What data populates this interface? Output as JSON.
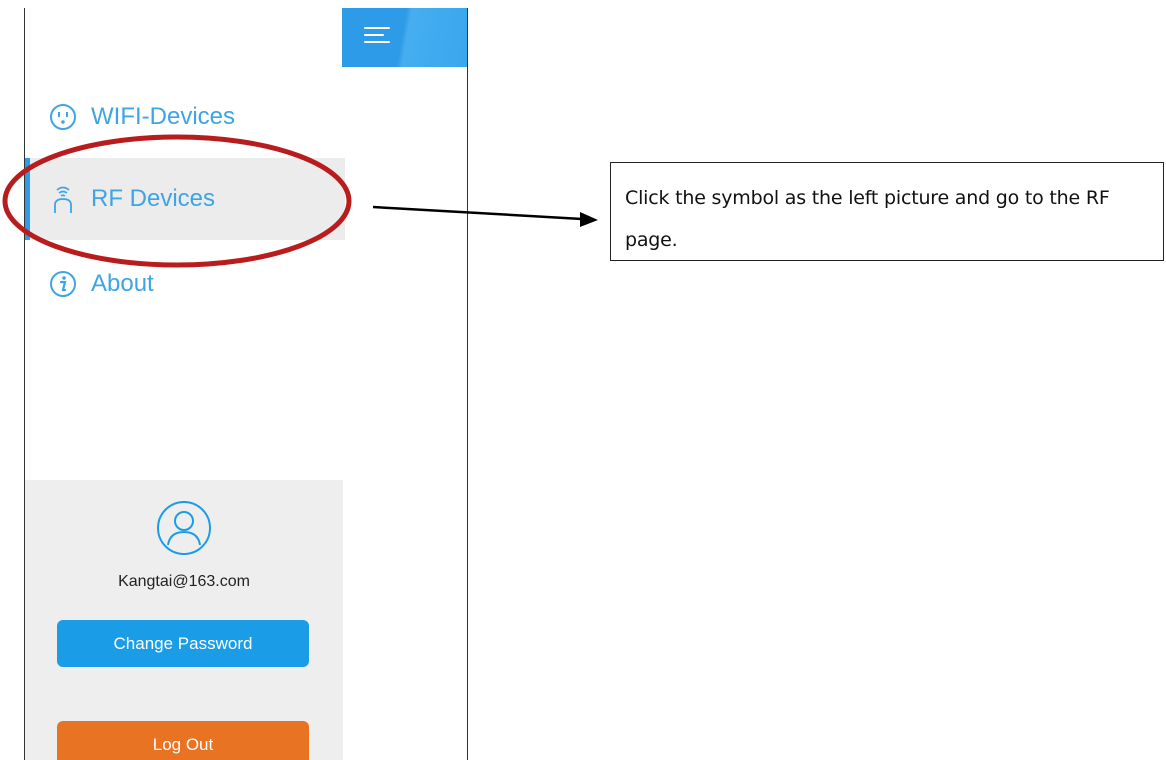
{
  "menu": {
    "items": [
      {
        "label": "WIFI-Devices",
        "icon": "outlet-icon",
        "active": false
      },
      {
        "label": "RF Devices",
        "icon": "rf-signal-icon",
        "active": true
      },
      {
        "label": "About",
        "icon": "info-icon",
        "active": false
      }
    ]
  },
  "account": {
    "email": "Kangtai@163.com",
    "change_password_label": "Change Password",
    "logout_label": "Log Out"
  },
  "annotation": {
    "callout_text": "Click the symbol as the left picture and go to the RF page."
  },
  "colors": {
    "accent": "#2e9be8",
    "menu_text": "#3ea4e4",
    "logout": "#e87322",
    "highlight_ellipse": "#b81c1c"
  }
}
